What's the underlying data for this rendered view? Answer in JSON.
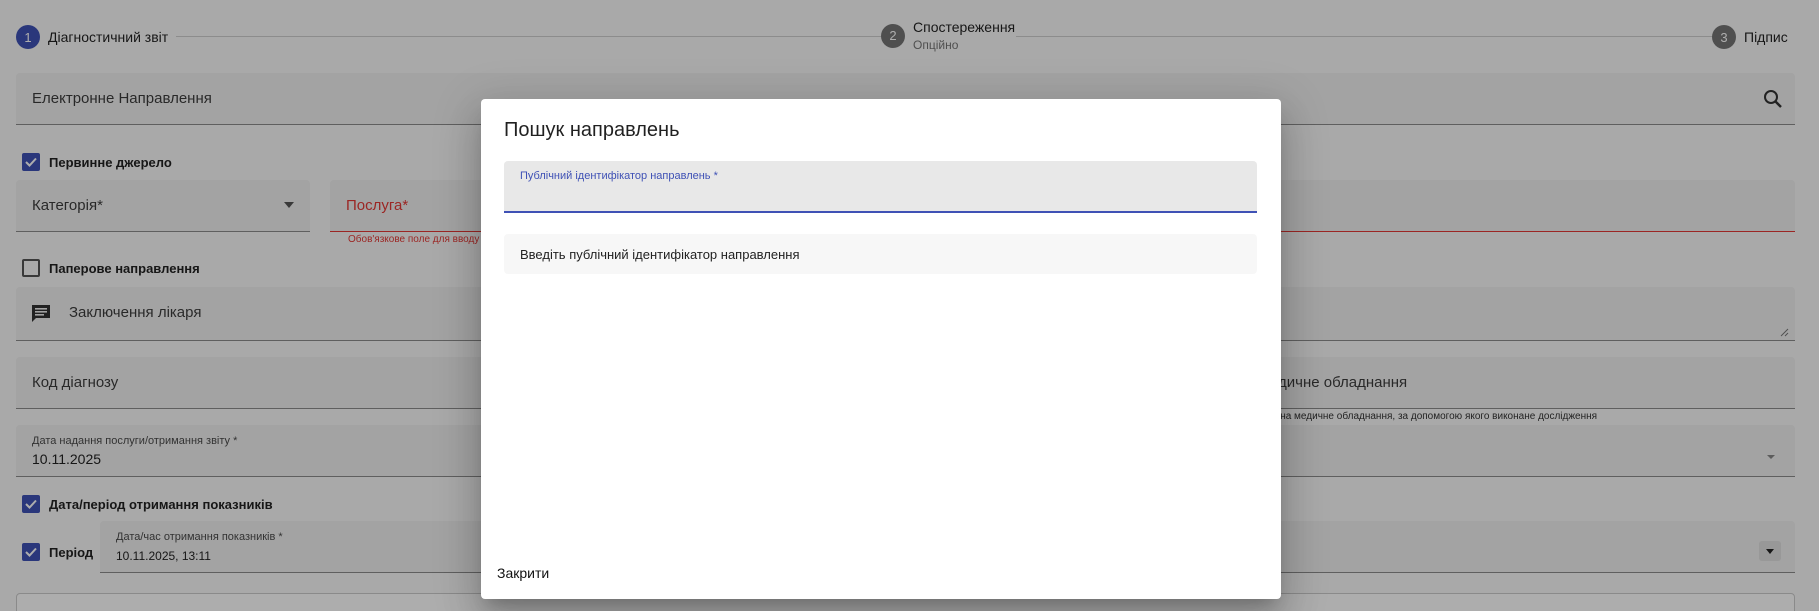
{
  "stepper": {
    "steps": [
      {
        "number": "1",
        "label": "Діагностичний звіт",
        "sub": ""
      },
      {
        "number": "2",
        "label": "Спостереження",
        "sub": "Опційно"
      },
      {
        "number": "3",
        "label": "Підпис",
        "sub": ""
      }
    ]
  },
  "form": {
    "referral_label": "Електронне Направлення",
    "primary_source_label": "Первинне джерело",
    "category_label": "Категорія*",
    "service_label": "Послуга*",
    "service_error": "Обов'язкове поле для вводу",
    "paper_referral_label": "Паперове направлення",
    "doctor_conclusion_label": "Заключення лікаря",
    "diagnosis_code_label": "Код діагнозу",
    "equipment_label": "едичне обладнання",
    "equipment_hint": "я на медичне обладнання, за допомогою якого виконане дослідження",
    "service_date_label": "Дата надання послуги/отримання звіту *",
    "service_date_value": "10.11.2025",
    "indicators_period_label": "Дата/період отримання показників",
    "period_label": "Період",
    "indicators_datetime_label": "Дата/час отримання показників *",
    "indicators_datetime_value": "10.11.2025, 13:11"
  },
  "dialog": {
    "title": "Пошук направлень",
    "field_label": "Публічний ідентифікатор направлень *",
    "field_value": "",
    "message": "Введіть публічний ідентифікатор направлення",
    "close_label": "Закрити"
  },
  "colors": {
    "primary": "#3f51b5",
    "error": "#e53935",
    "backdrop": "rgba(0,0,0,0.32)"
  }
}
